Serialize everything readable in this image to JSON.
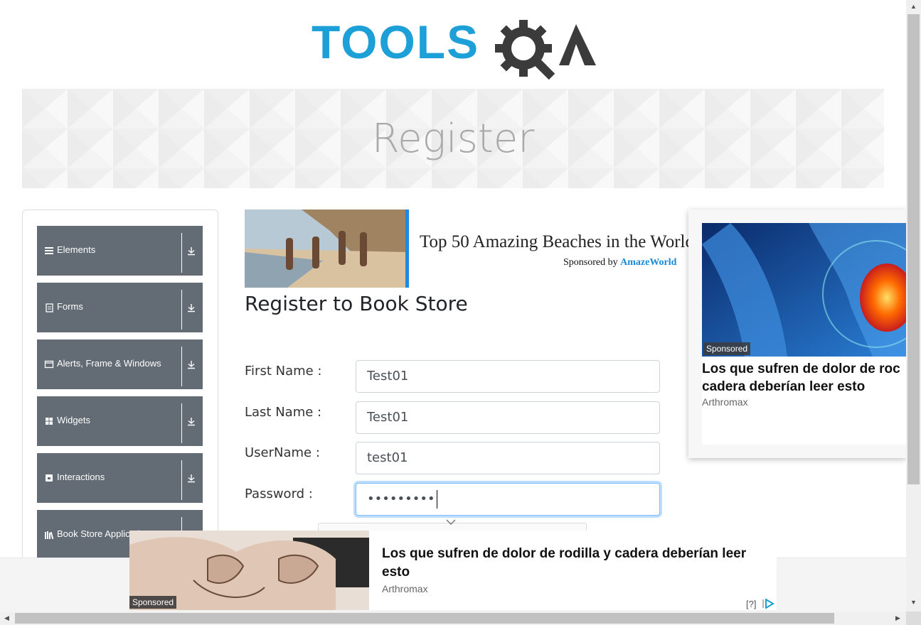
{
  "logo": {
    "text_tools": "TOOLS",
    "text_qa": "QA"
  },
  "banner": {
    "title": "Register"
  },
  "sidebar": {
    "groups": [
      {
        "label": "Elements",
        "icon": "menu-lines-icon"
      },
      {
        "label": "Forms",
        "icon": "document-icon"
      },
      {
        "label": "Alerts, Frame & Windows",
        "icon": "window-icon"
      },
      {
        "label": "Widgets",
        "icon": "grid-icon"
      },
      {
        "label": "Interactions",
        "icon": "box-icon"
      },
      {
        "label": "Book Store Applicati",
        "icon": "books-icon"
      }
    ]
  },
  "ad_beach": {
    "title": "Top 50 Amazing Beaches in the Worlc",
    "sponsored_prefix": "Sponsored by",
    "sponsor": "AmazeWorld"
  },
  "form": {
    "heading": "Register to Book Store",
    "first_name_label": "First Name :",
    "first_name_value": "Test01",
    "last_name_label": "Last Name :",
    "last_name_value": "Test01",
    "username_label": "UserName :",
    "username_value": "test01",
    "password_label": "Password :",
    "password_value": "•••••••••"
  },
  "ad_right": {
    "badge": "Sponsored",
    "title_line1": "Los que sufren de dolor de roc",
    "title_line2": "cadera deberían leer esto",
    "brand": "Arthromax"
  },
  "ad_bottom": {
    "badge": "Sponsored",
    "title": "Los que sufren de dolor de rodilla y cadera deberían leer esto",
    "brand": "Arthromax",
    "info": "[?]"
  },
  "colors": {
    "sidebar_group": "#636b74",
    "logo_blue": "#1d9fd8",
    "logo_dark": "#3b3b3b",
    "focus_border": "#80bdff"
  }
}
